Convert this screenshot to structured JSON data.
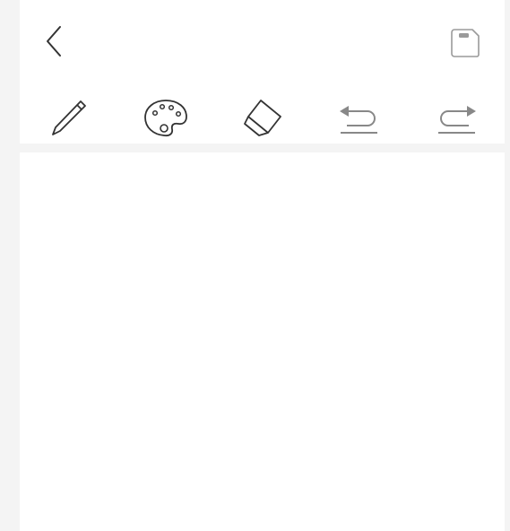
{
  "header": {
    "back_icon": "chevron-left-icon",
    "save_icon": "save-icon"
  },
  "toolbar": {
    "tools": [
      {
        "id": "pen",
        "icon": "pencil-icon"
      },
      {
        "id": "color",
        "icon": "palette-icon"
      },
      {
        "id": "eraser",
        "icon": "eraser-icon"
      },
      {
        "id": "undo",
        "icon": "undo-icon"
      },
      {
        "id": "redo",
        "icon": "redo-icon"
      }
    ]
  },
  "colors": {
    "background": "#f4f4f4",
    "surface": "#ffffff",
    "icon_dark": "#333333",
    "icon_gray": "#888888",
    "icon_light": "#9a9a9a"
  }
}
